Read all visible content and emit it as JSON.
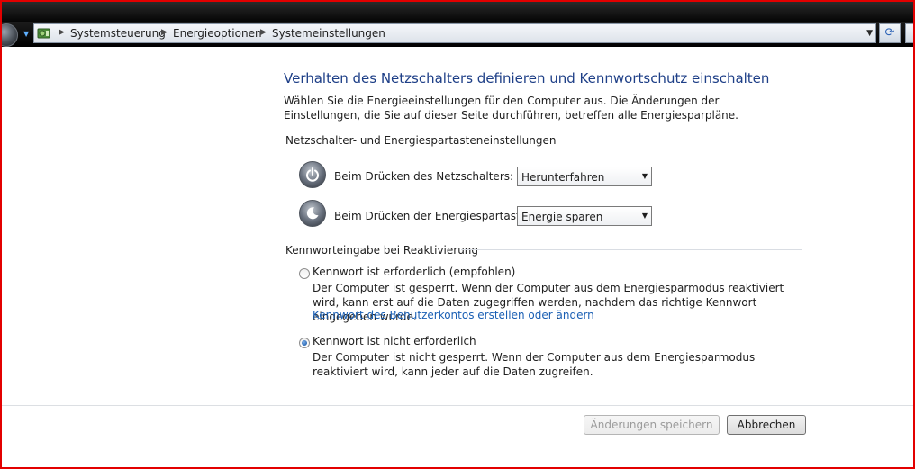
{
  "address": {
    "breadcrumbs": [
      "Systemsteuerung",
      "Energieoptionen",
      "Systemeinstellungen"
    ]
  },
  "page": {
    "title": "Verhalten des Netzschalters definieren und Kennwortschutz einschalten",
    "intro": "Wählen Sie die Energieeinstellungen für den Computer aus. Die Änderungen der Einstellungen, die Sie auf dieser Seite durchführen, betreffen alle Energiesparpläne."
  },
  "power_section": {
    "title": "Netzschalter- und Energiespartasteneinstellungen",
    "rows": [
      {
        "label": "Beim Drücken des Netzschalters:",
        "value": "Herunterfahren",
        "icon": "power-button-icon"
      },
      {
        "label": "Beim Drücken der Energiespartaste:",
        "value": "Energie sparen",
        "icon": "sleep-button-icon"
      }
    ]
  },
  "password_section": {
    "title": "Kennworteingabe bei Reaktivierung",
    "options": [
      {
        "label": "Kennwort ist erforderlich (empfohlen)",
        "desc": "Der Computer ist gesperrt. Wenn der Computer aus dem Energiesparmodus reaktiviert wird, kann erst auf die Daten zugegriffen werden, nachdem das richtige Kennwort eingegeben wurde.",
        "link": "Kennwort des Benutzerkontos erstellen oder ändern",
        "link_suffix": ".",
        "selected": false
      },
      {
        "label": "Kennwort ist nicht erforderlich",
        "desc": "Der Computer ist nicht gesperrt. Wenn der Computer aus dem Energiesparmodus reaktiviert wird, kann jeder auf die Daten zugreifen.",
        "selected": true
      }
    ]
  },
  "footer": {
    "save_label": "Änderungen speichern",
    "cancel_label": "Abbrechen"
  }
}
